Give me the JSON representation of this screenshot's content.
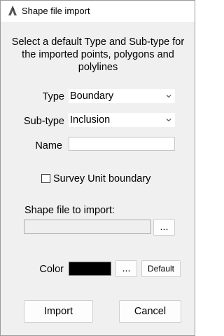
{
  "window": {
    "title": "Shape file import"
  },
  "instructions": "Select a default Type and Sub-type for the imported points, polygons and polylines",
  "form": {
    "type_label": "Type",
    "type_value": "Boundary",
    "subtype_label": "Sub-type",
    "subtype_value": "Inclusion",
    "name_label": "Name",
    "name_value": "",
    "survey_unit_label": "Survey Unit boundary",
    "survey_unit_checked": false,
    "shape_file_label": "Shape file to import:",
    "shape_file_value": "",
    "browse_label": "...",
    "color_label": "Color",
    "color_value": "#000000",
    "color_browse_label": "...",
    "default_label": "Default"
  },
  "actions": {
    "import_label": "Import",
    "cancel_label": "Cancel"
  },
  "icons": {
    "app": "app-logo-icon",
    "dropdown": "chevron-down-icon"
  }
}
